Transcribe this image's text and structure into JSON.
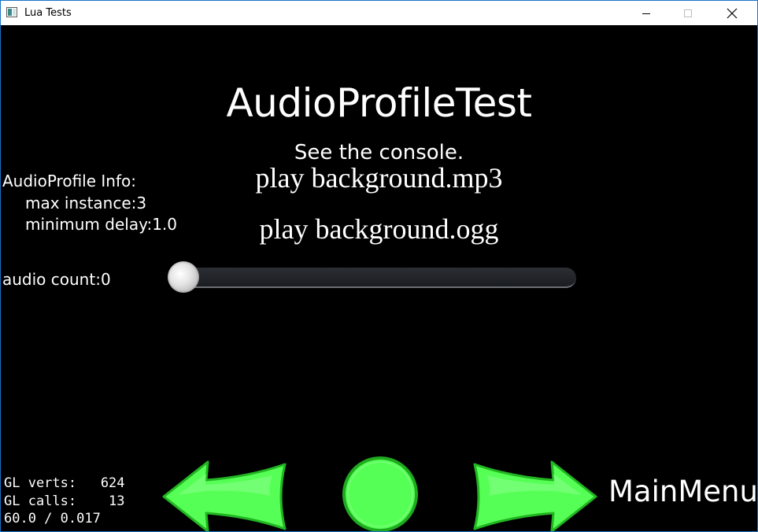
{
  "window": {
    "title": "Lua Tests",
    "controls": [
      "minimize",
      "maximize",
      "close"
    ]
  },
  "scene": {
    "title": "AudioProfileTest",
    "subtitle": "See the console.",
    "menu_items": [
      "play background.mp3",
      "play background.ogg"
    ],
    "info": {
      "heading": "AudioProfile Info:",
      "max_instance": "max instance:3",
      "minimum_delay": "minimum delay:1.0"
    },
    "audio_count_label": "audio count:0",
    "slider_value": 0
  },
  "stats": {
    "gl_verts": "GL verts:   624",
    "gl_calls": "GL calls:    13",
    "fps": "60.0 / 0.017"
  },
  "nav": {
    "main_menu": "MainMenu"
  },
  "colors": {
    "button_green": "#55ff55",
    "button_dark": "#1faa1f",
    "window_border": "#1a73c9"
  },
  "icons": {
    "back": "left-arrow-icon",
    "restart": "circle-icon",
    "next": "right-arrow-icon"
  }
}
